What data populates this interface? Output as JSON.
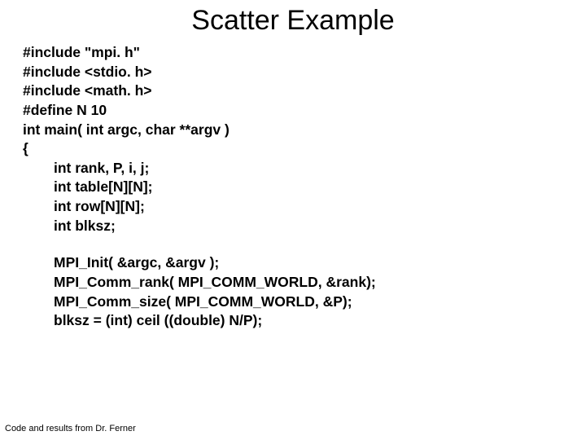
{
  "title": "Scatter Example",
  "code": {
    "l1": "#include \"mpi. h\"",
    "l2": "#include <stdio. h>",
    "l3": "#include <math. h>",
    "l4": "#define N 10",
    "l5": "int main( int argc, char **argv )",
    "l6": "{",
    "l7": "int rank, P, i, j;",
    "l8": "int table[N][N];",
    "l9": "int row[N][N];",
    "l10": "int blksz;",
    "l11": "MPI_Init( &argc, &argv );",
    "l12": "MPI_Comm_rank( MPI_COMM_WORLD,  &rank);",
    "l13": "MPI_Comm_size( MPI_COMM_WORLD, &P);",
    "l14": "blksz = (int) ceil ((double) N/P);"
  },
  "footnote": "Code and results from Dr. Ferner"
}
